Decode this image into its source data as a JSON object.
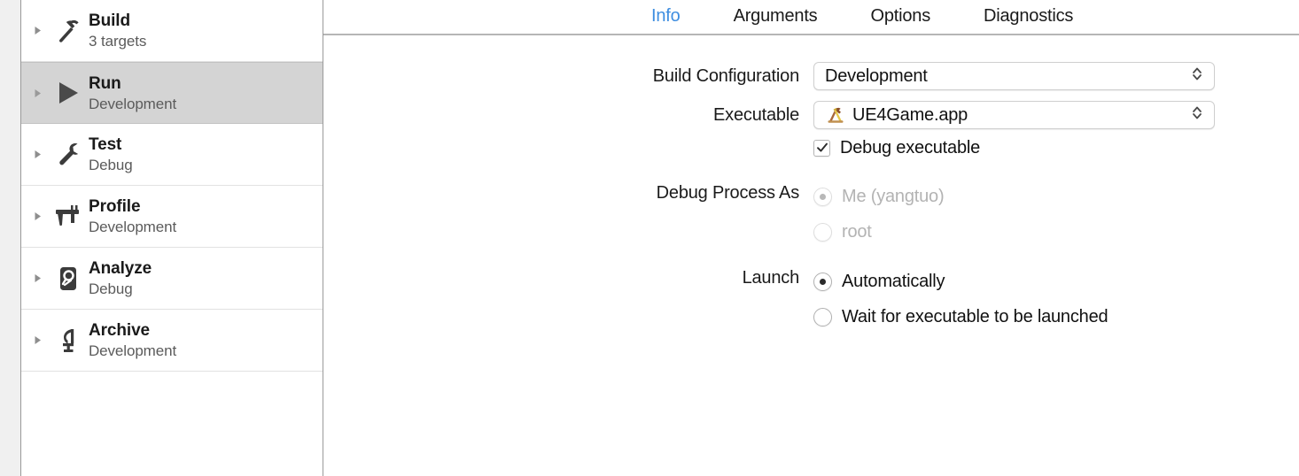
{
  "sidebar": {
    "items": [
      {
        "title": "Build",
        "subtitle": "3 targets",
        "icon": "hammer-icon",
        "selected": false
      },
      {
        "title": "Run",
        "subtitle": "Development",
        "icon": "play-icon",
        "selected": true
      },
      {
        "title": "Test",
        "subtitle": "Debug",
        "icon": "wrench-icon",
        "selected": false
      },
      {
        "title": "Profile",
        "subtitle": "Development",
        "icon": "calipers-icon",
        "selected": false
      },
      {
        "title": "Analyze",
        "subtitle": "Debug",
        "icon": "analyze-icon",
        "selected": false
      },
      {
        "title": "Archive",
        "subtitle": "Development",
        "icon": "clamp-icon",
        "selected": false
      }
    ]
  },
  "tabs": [
    {
      "label": "Info",
      "active": true
    },
    {
      "label": "Arguments",
      "active": false
    },
    {
      "label": "Options",
      "active": false
    },
    {
      "label": "Diagnostics",
      "active": false
    }
  ],
  "form": {
    "build_configuration": {
      "label": "Build Configuration",
      "value": "Development",
      "stepper_icon": "chevron-up-down-icon"
    },
    "executable": {
      "label": "Executable",
      "value": "UE4Game.app",
      "app_icon": "xcode-app-icon",
      "stepper_icon": "chevron-up-down-icon"
    },
    "debug_executable": {
      "label": "Debug executable",
      "checked": true,
      "check_icon": "checkmark-icon"
    },
    "debug_process_as": {
      "label": "Debug Process As",
      "disabled": true,
      "options": [
        {
          "label": "Me (yangtuo)",
          "selected": true
        },
        {
          "label": "root",
          "selected": false
        }
      ]
    },
    "launch": {
      "label": "Launch",
      "options": [
        {
          "label": "Automatically",
          "selected": true
        },
        {
          "label": "Wait for executable to be launched",
          "selected": false
        }
      ]
    }
  },
  "colors": {
    "accent_blue": "#3f8ee0",
    "selected_row": "#d4d4d4",
    "gutter": "#f0f0f0",
    "divider": "#9a9a9a",
    "disabled_text": "#b3b3b3"
  }
}
